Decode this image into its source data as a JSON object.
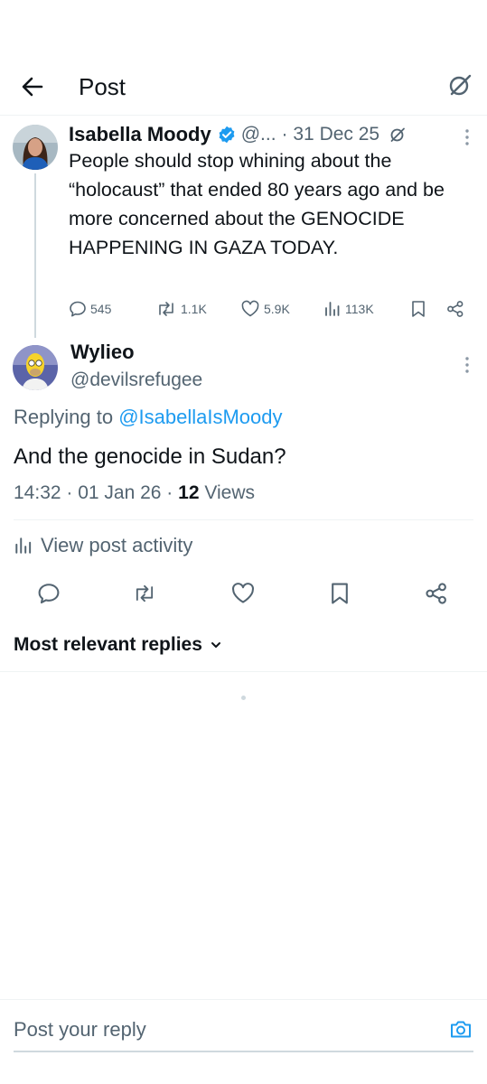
{
  "header": {
    "title": "Post"
  },
  "parent_post": {
    "author_name": "Isabella Moody",
    "handle": "@...",
    "date": "· 31 Dec 25",
    "text": "People should stop whining about the “holocaust” that ended 80 years ago and be more concerned about the GENOCIDE HAPPENING IN GAZA TODAY.",
    "stats": {
      "replies": "545",
      "reposts": "1.1K",
      "likes": "5.9K",
      "views": "113K"
    }
  },
  "reply_post": {
    "author_name": "Wylieo",
    "handle": "@devilsrefugee",
    "replying_prefix": "Replying to",
    "replying_to": "@IsabellaIsMoody",
    "text": "And the genocide in Sudan?",
    "timestamp": "14:32 · 01 Jan 26 ·",
    "views_count": "12",
    "views_label": "Views",
    "view_activity": "View post activity"
  },
  "replies_sort": {
    "label": "Most relevant replies"
  },
  "composer": {
    "placeholder": "Post your reply"
  },
  "colors": {
    "accent": "#1d9bf0",
    "text": "#0f1419",
    "muted": "#536471",
    "divider": "#eff3f4"
  },
  "icons": [
    "back-arrow-icon",
    "grok-icon",
    "verified-badge-icon",
    "more-icon",
    "reply-icon",
    "repost-icon",
    "like-icon",
    "views-icon",
    "bookmark-icon",
    "share-icon",
    "chevron-down-icon",
    "camera-icon"
  ]
}
